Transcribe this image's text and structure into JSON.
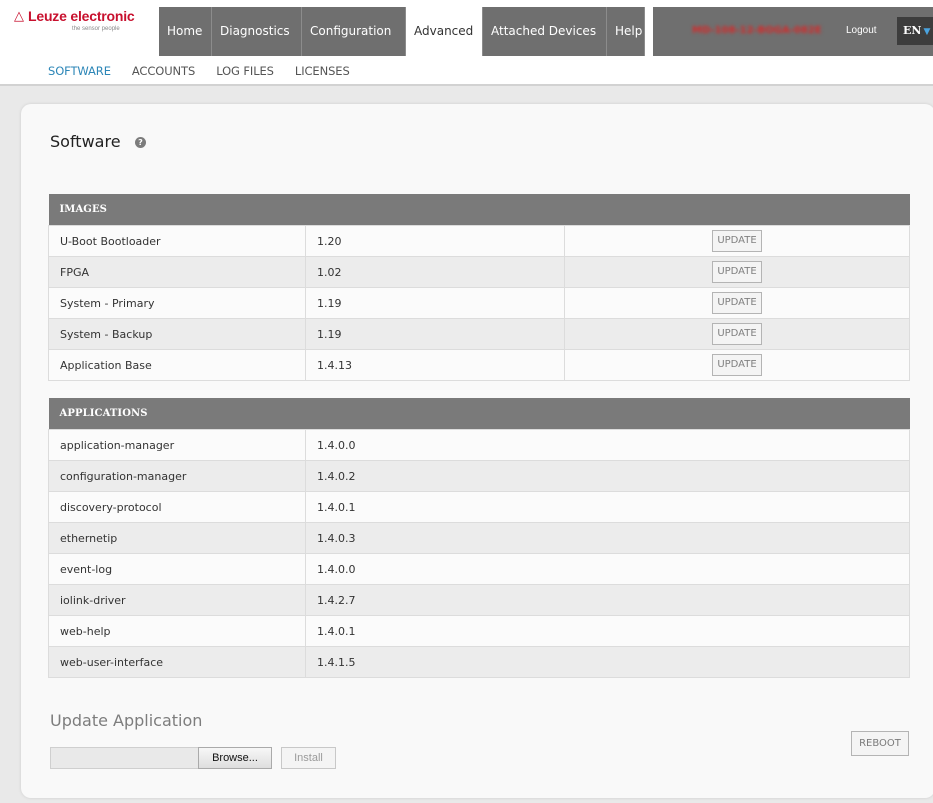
{
  "brand": {
    "name": "Leuze electronic",
    "tagline": "the sensor people",
    "logo_color": "#c8102e"
  },
  "nav": {
    "tabs": [
      {
        "label": "Home",
        "active": false
      },
      {
        "label": "Diagnostics",
        "active": false
      },
      {
        "label": "Configuration",
        "active": false
      },
      {
        "label": "Advanced",
        "active": true
      },
      {
        "label": "Attached Devices",
        "active": false
      },
      {
        "label": "Help",
        "active": false
      }
    ],
    "serial": "MD-108-12-BOGA-082E",
    "logout": "Logout",
    "language": "EN"
  },
  "subnav": {
    "items": [
      {
        "label": "SOFTWARE",
        "active": true
      },
      {
        "label": "ACCOUNTS",
        "active": false
      },
      {
        "label": "LOG FILES",
        "active": false
      },
      {
        "label": "LICENSES",
        "active": false
      }
    ]
  },
  "page": {
    "title": "Software",
    "help_icon": "question-icon"
  },
  "images": {
    "header": "IMAGES",
    "update_label": "UPDATE",
    "rows": [
      {
        "name": "U-Boot Bootloader",
        "version": "1.20"
      },
      {
        "name": "FPGA",
        "version": "1.02"
      },
      {
        "name": "System - Primary",
        "version": "1.19"
      },
      {
        "name": "System - Backup",
        "version": "1.19"
      },
      {
        "name": "Application Base",
        "version": "1.4.13"
      }
    ]
  },
  "applications": {
    "header": "APPLICATIONS",
    "rows": [
      {
        "name": "application-manager",
        "version": "1.4.0.0"
      },
      {
        "name": "configuration-manager",
        "version": "1.4.0.2"
      },
      {
        "name": "discovery-protocol",
        "version": "1.4.0.1"
      },
      {
        "name": "ethernetip",
        "version": "1.4.0.3"
      },
      {
        "name": "event-log",
        "version": "1.4.0.0"
      },
      {
        "name": "iolink-driver",
        "version": "1.4.2.7"
      },
      {
        "name": "web-help",
        "version": "1.4.0.1"
      },
      {
        "name": "web-user-interface",
        "version": "1.4.1.5"
      }
    ]
  },
  "update_app": {
    "title": "Update Application",
    "browse_label": "Browse...",
    "install_label": "Install",
    "reboot_label": "REBOOT"
  }
}
